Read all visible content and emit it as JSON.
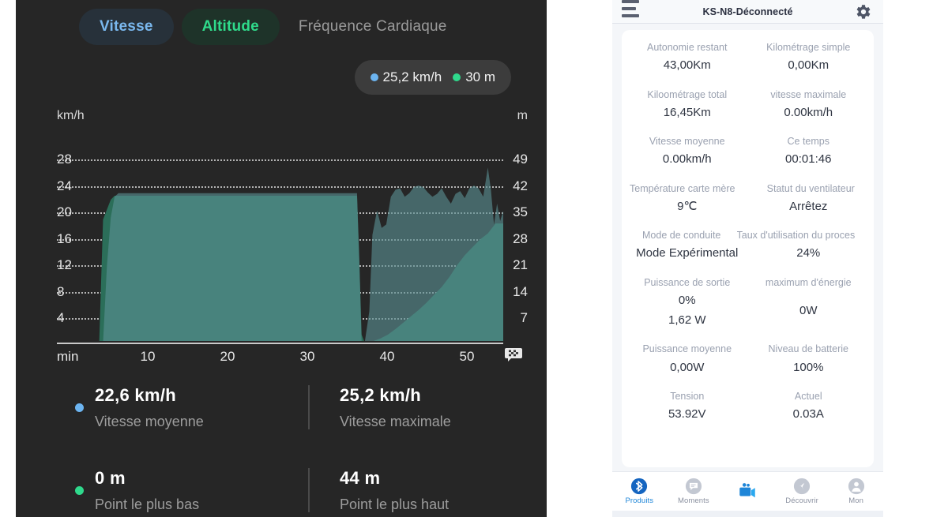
{
  "left": {
    "tabs": [
      {
        "label": "Vitesse",
        "state": "active-speed"
      },
      {
        "label": "Altitude",
        "state": "active-alt"
      },
      {
        "label": "Fréquence Cardiaque",
        "state": "inactive"
      }
    ],
    "legend": [
      {
        "label": "25,2 km/h",
        "color": "#6cb4f0"
      },
      {
        "label": "30 m",
        "color": "#2fd98c"
      }
    ],
    "axis": {
      "left_unit": "km/h",
      "right_unit": "m",
      "x_unit": "min",
      "left_ticks": [
        "28",
        "24",
        "20",
        "16",
        "12",
        "8",
        "4"
      ],
      "right_ticks": [
        "49",
        "42",
        "35",
        "28",
        "21",
        "14",
        "7"
      ],
      "x_ticks": [
        "10",
        "20",
        "30",
        "40",
        "50"
      ],
      "end_icon": "checkered-flag-icon"
    },
    "stats": [
      {
        "bullet": "#6cb4f0",
        "value": "22,6 km/h",
        "label": "Vitesse moyenne"
      },
      {
        "bullet": "",
        "value": "25,2 km/h",
        "label": "Vitesse maximale"
      },
      {
        "bullet": "#2fd98c",
        "value": "0 m",
        "label": "Point le plus bas"
      },
      {
        "bullet": "",
        "value": "44 m",
        "label": "Point le plus haut"
      }
    ]
  },
  "chart_data": {
    "type": "area",
    "title": "",
    "xlabel": "min",
    "ylabel": "km/h",
    "y2label": "m",
    "ylim": [
      0,
      30
    ],
    "y2lim": [
      0,
      52.5
    ],
    "xlim": [
      0,
      58
    ],
    "grid": true,
    "legend_position": "top-right",
    "yticks": [
      4,
      8,
      12,
      16,
      20,
      24,
      28
    ],
    "y2ticks": [
      7,
      14,
      21,
      28,
      35,
      42,
      49
    ],
    "xticks": [
      10,
      20,
      30,
      40,
      50
    ],
    "series": [
      {
        "name": "Altitude",
        "unit": "m",
        "color": "#2f7f68",
        "axis": "right",
        "x": [
          0,
          5.5,
          6.0,
          7.0,
          7.5,
          38.5,
          39.0,
          39.3,
          39.6,
          40.0,
          41.0,
          42.0,
          43.0,
          44.0,
          45.0,
          46.0,
          47.0,
          48.0,
          49.0,
          50.0,
          51.0,
          52.0,
          53.0,
          54.0,
          55.0,
          56.0,
          57.0,
          58.0
        ],
        "y": [
          0,
          0,
          31,
          36,
          37,
          37,
          37,
          20,
          2,
          0,
          0.3,
          1.0,
          2.0,
          3.4,
          5.0,
          6.6,
          8.2,
          10.0,
          12.0,
          14.0,
          16.5,
          19.5,
          22.0,
          24.0,
          26.0,
          27.5,
          30.0,
          30.0
        ]
      },
      {
        "name": "Vitesse",
        "unit": "km/h",
        "color": "#42706f",
        "axis": "left",
        "x": [
          0,
          6.0,
          6.5,
          7.0,
          7.5,
          8.0,
          38.5,
          39.0,
          39.3,
          39.6,
          40.0,
          40.6,
          41.0,
          41.6,
          42.2,
          42.8,
          43.4,
          44.0,
          44.6,
          45.2,
          45.8,
          46.4,
          47.0,
          47.6,
          48.2,
          48.8,
          49.4,
          50.0,
          50.6,
          51.2,
          51.8,
          52.4,
          53.0,
          53.6,
          54.2,
          54.8,
          55.4,
          56.0,
          56.4,
          56.8,
          57.2,
          57.6,
          58.0
        ],
        "y": [
          0,
          0,
          11,
          18,
          21,
          21.5,
          21.5,
          21.5,
          12,
          0,
          0,
          4.5,
          15.5,
          19.0,
          16.5,
          17.0,
          21.0,
          22.0,
          22.2,
          21.0,
          21.5,
          22.4,
          22.6,
          22.4,
          21.6,
          21.0,
          21.4,
          22.2,
          21.0,
          20.0,
          21.4,
          21.8,
          20.8,
          22.2,
          22.6,
          22.2,
          21.0,
          25.2,
          22.0,
          17.0,
          20.0,
          17.5,
          19.0
        ]
      }
    ],
    "annotations": {
      "avg_speed": 22.6,
      "max_speed": 25.2,
      "min_alt": 0,
      "max_alt": 44
    }
  },
  "phone": {
    "header": {
      "title": "KS-N8-Déconnecté",
      "menu_icon": "hamburger-icon",
      "settings_icon": "gear-icon"
    },
    "metrics": [
      {
        "label": "Autonomie restant",
        "value": "43,00Km"
      },
      {
        "label": "Kilométrage simple",
        "value": "0,00Km"
      },
      {
        "label": "Kiloométrage total",
        "value": "16,45Km"
      },
      {
        "label": "vitesse maximale",
        "value": "0.00km/h"
      },
      {
        "label": "Vitesse moyenne",
        "value": "0.00km/h"
      },
      {
        "label": "Ce temps",
        "value": "00:01:46"
      },
      {
        "label": "Température carte mère",
        "value": "9℃"
      },
      {
        "label": "Statut du ventilateur",
        "value": "Arrêtez"
      },
      {
        "label": "Mode de conduite",
        "value": "Mode Expérimental"
      },
      {
        "label": "Taux d'utilisation du proces",
        "value": "24%"
      },
      {
        "label": "Puissance de sortie",
        "value": "0%",
        "value2": "1,62 W"
      },
      {
        "label": "maximum d'énergie",
        "value": "0W"
      },
      {
        "label": "Puissance moyenne",
        "value": "0,00W"
      },
      {
        "label": "Niveau de batterie",
        "value": "100%"
      },
      {
        "label": "Tension",
        "value": "53.92V"
      },
      {
        "label": "Actuel",
        "value": "0.03A"
      }
    ],
    "nav": [
      {
        "label": "Produits",
        "icon": "bluetooth-icon",
        "active": true
      },
      {
        "label": "Moments",
        "icon": "chat-bubble-icon",
        "active": false
      },
      {
        "label": "",
        "icon": "video-camera-icon",
        "active": false
      },
      {
        "label": "Découvrir",
        "icon": "compass-icon",
        "active": false
      },
      {
        "label": "Mon",
        "icon": "person-icon",
        "active": false
      }
    ],
    "colors": {
      "accent": "#1f86d8",
      "label": "#9aa1b0",
      "value": "#2f3542"
    }
  }
}
